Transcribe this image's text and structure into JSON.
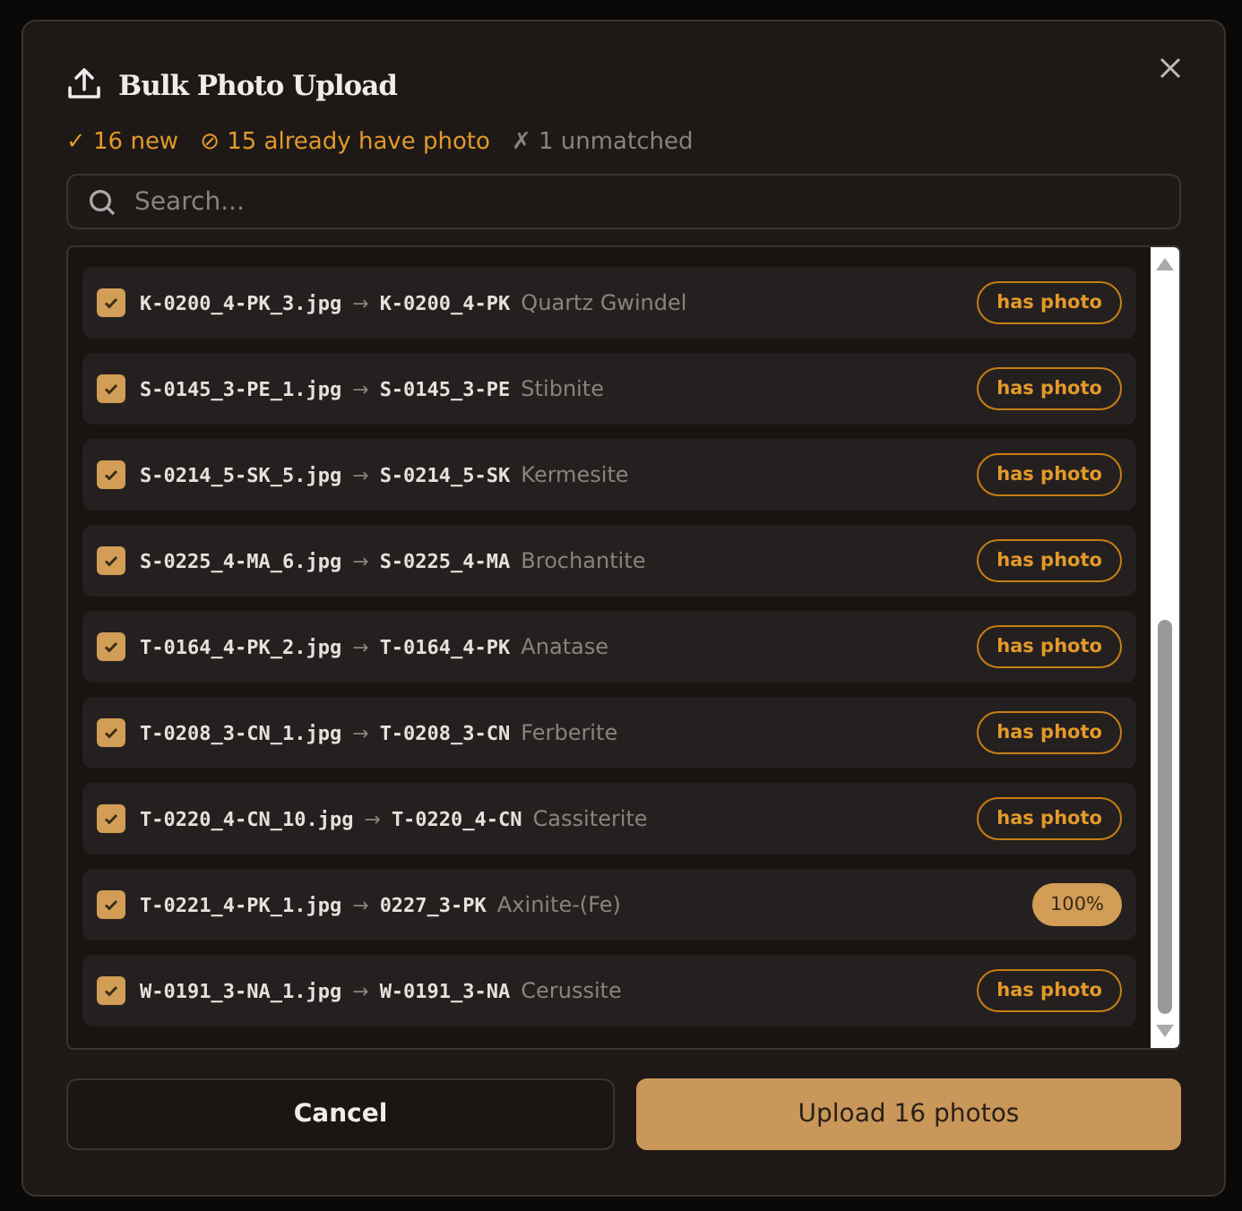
{
  "dialog": {
    "title": "Bulk Photo Upload"
  },
  "summary": [
    {
      "kind": "new",
      "icon": "✓",
      "text": "16 new"
    },
    {
      "kind": "existing",
      "icon": "⊘",
      "text": "15 already have photo"
    },
    {
      "kind": "unmatched",
      "icon": "✗",
      "text": "1 unmatched"
    }
  ],
  "search": {
    "placeholder": "Search..."
  },
  "rows": [
    {
      "checked": true,
      "file": "K-0200_4-PK_3.jpg",
      "arrow": "→",
      "code": "K-0200_4-PK",
      "name": "Quartz Gwindel",
      "kind": "existing",
      "status": "has photo"
    },
    {
      "checked": true,
      "file": "S-0145_3-PE_1.jpg",
      "arrow": "→",
      "code": "S-0145_3-PE",
      "name": "Stibnite",
      "kind": "existing",
      "status": "has photo"
    },
    {
      "checked": true,
      "file": "S-0214_5-SK_5.jpg",
      "arrow": "→",
      "code": "S-0214_5-SK",
      "name": "Kermesite",
      "kind": "existing",
      "status": "has photo"
    },
    {
      "checked": true,
      "file": "S-0225_4-MA_6.jpg",
      "arrow": "→",
      "code": "S-0225_4-MA",
      "name": "Brochantite",
      "kind": "existing",
      "status": "has photo"
    },
    {
      "checked": true,
      "file": "T-0164_4-PK_2.jpg",
      "arrow": "→",
      "code": "T-0164_4-PK",
      "name": "Anatase",
      "kind": "existing",
      "status": "has photo"
    },
    {
      "checked": true,
      "file": "T-0208_3-CN_1.jpg",
      "arrow": "→",
      "code": "T-0208_3-CN",
      "name": "Ferberite",
      "kind": "existing",
      "status": "has photo"
    },
    {
      "checked": true,
      "file": "T-0220_4-CN_10.jpg",
      "arrow": "→",
      "code": "T-0220_4-CN",
      "name": "Cassiterite",
      "kind": "existing",
      "status": "has photo"
    },
    {
      "checked": true,
      "file": "T-0221_4-PK_1.jpg",
      "arrow": "→",
      "code": "0227_3-PK",
      "name": "Axinite-(Fe)",
      "kind": "progress",
      "status": "100%"
    },
    {
      "checked": true,
      "file": "W-0191_3-NA_1.jpg",
      "arrow": "→",
      "code": "W-0191_3-NA",
      "name": "Cerussite",
      "kind": "existing",
      "status": "has photo"
    }
  ],
  "buttons": [
    {
      "kind": "secondary",
      "label": "Cancel"
    },
    {
      "kind": "primary",
      "label": "Upload 16 photos"
    }
  ]
}
